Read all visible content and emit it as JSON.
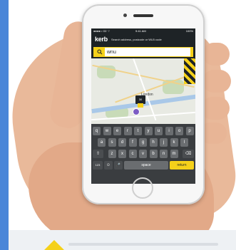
{
  "app": {
    "logo": "kerb",
    "tagline": "Search address, postcode or WLB code"
  },
  "statusbar": {
    "carrier": "●●●●○ O2 ⌔",
    "time": "9:41 AM",
    "battery": "100%"
  },
  "search": {
    "icon": "search-icon",
    "value": "wnu"
  },
  "map": {
    "place": "London",
    "pin_label": "30"
  },
  "keyboard": {
    "row1": [
      "q",
      "w",
      "e",
      "r",
      "t",
      "y",
      "u",
      "i",
      "o",
      "p"
    ],
    "row2": [
      "a",
      "s",
      "d",
      "f",
      "g",
      "h",
      "j",
      "k",
      "l"
    ],
    "row3": [
      "z",
      "x",
      "c",
      "v",
      "b",
      "n",
      "m"
    ],
    "shift": "⇧",
    "delete": "⌫",
    "numbers": "123",
    "emoji": "☺",
    "mic": "🎤",
    "space": "space",
    "return": "return"
  },
  "colors": {
    "accent": "#f5d11a",
    "dark": "#1e2326",
    "side_strip": "#4a86d8"
  }
}
